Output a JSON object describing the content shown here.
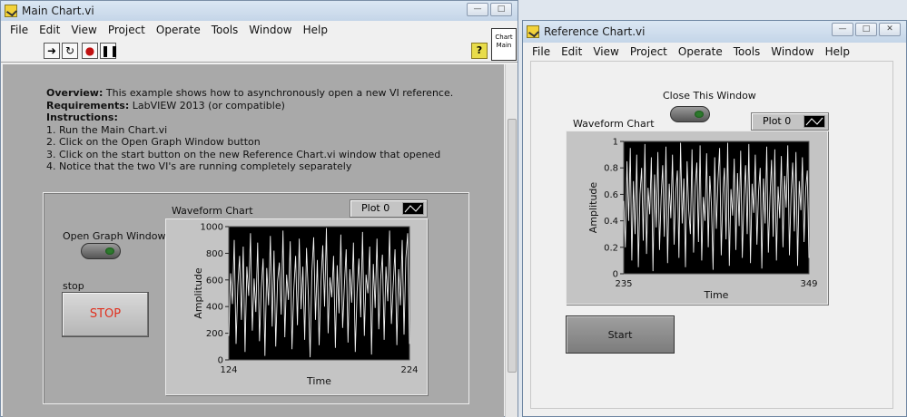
{
  "main_window": {
    "title": "Main Chart.vi",
    "menu": [
      "File",
      "Edit",
      "View",
      "Project",
      "Operate",
      "Tools",
      "Window",
      "Help"
    ],
    "toolbar_icons": [
      "run-arrow-icon",
      "run-continuously-icon",
      "abort-icon",
      "pause-icon"
    ],
    "help_label": "?",
    "vi_icon_text": "Chart Main",
    "overview": {
      "overview_label": "Overview:",
      "overview_text": " This example shows how to asynchronously open a new VI reference.",
      "requirements_label": "Requirements:",
      "requirements_text": " LabVIEW 2013 (or compatible)",
      "instructions_label": "Instructions:",
      "steps": [
        "1. Run the Main Chart.vi",
        "2. Click on the Open Graph Window button",
        "3. Click on the start button on the new Reference Chart.vi window that opened",
        "4. Notice that the two VI's are running completely separately"
      ]
    },
    "open_graph_label": "Open Graph Window",
    "stop_label": "stop",
    "stop_button_text": "STOP",
    "chart": {
      "title": "Waveform Chart",
      "legend": "Plot 0",
      "xlabel": "Time",
      "ylabel": "Amplitude"
    }
  },
  "reference_window": {
    "title": "Reference Chart.vi",
    "menu": [
      "File",
      "Edit",
      "View",
      "Project",
      "Operate",
      "Tools",
      "Window",
      "Help"
    ],
    "close_label": "Close This Window",
    "start_button_text": "Start",
    "chart": {
      "title": "Waveform Chart",
      "legend": "Plot 0",
      "xlabel": "Time",
      "ylabel": "Amplitude"
    }
  },
  "chart_data": [
    {
      "type": "line",
      "title": "Waveform Chart",
      "xlabel": "Time",
      "ylabel": "Amplitude",
      "series": [
        {
          "name": "Plot 0",
          "values": [
            180,
            650,
            420,
            900,
            120,
            560,
            780,
            300,
            850,
            60,
            700,
            480,
            950,
            220,
            610,
            360,
            880,
            140,
            540,
            760,
            30,
            690,
            410,
            930,
            250,
            820,
            100,
            590,
            730,
            340,
            970,
            170,
            640,
            450,
            890,
            80,
            520,
            780,
            260,
            910,
            380,
            700,
            150,
            840,
            490,
            20,
            660,
            920,
            300,
            750,
            110,
            580,
            860,
            400,
            990,
            200,
            620,
            470,
            780,
            90,
            710,
            350,
            940,
            240,
            570,
            830,
            130,
            680,
            430,
            880,
            60,
            510,
            760,
            320,
            960,
            180,
            640,
            500,
            850,
            40,
            720,
            390,
            910,
            230,
            600,
            790,
            150,
            700,
            440,
            970,
            270,
            560,
            830,
            110,
            680,
            410,
            900,
            190,
            760,
            950,
            120
          ]
        }
      ],
      "x": [
        124,
        224
      ],
      "xticks": [
        "124",
        "224"
      ],
      "ylim": [
        0,
        1000
      ],
      "yticks": [
        "0",
        "200",
        "400",
        "600",
        "800",
        "1000"
      ]
    },
    {
      "type": "line",
      "title": "Waveform Chart",
      "xlabel": "Time",
      "ylabel": "Amplitude",
      "series": [
        {
          "name": "Plot 0",
          "values": [
            0.55,
            0.2,
            0.85,
            0.4,
            0.95,
            0.1,
            0.7,
            0.3,
            0.9,
            0.05,
            0.6,
            0.8,
            0.25,
            0.98,
            0.15,
            0.65,
            0.45,
            0.88,
            0.02,
            0.75,
            0.35,
            0.92,
            0.18,
            0.58,
            0.82,
            0.28,
            0.96,
            0.08,
            0.68,
            0.42,
            0.9,
            0.22,
            0.62,
            0.78,
            0.12,
            0.99,
            0.38,
            0.72,
            0.05,
            0.85,
            0.48,
            0.3,
            0.94,
            0.16,
            0.66,
            0.84,
            0.24,
            0.97,
            0.1,
            0.58,
            0.4,
            0.91,
            0.2,
            0.74,
            0.52,
            0.03,
            0.88,
            0.34,
            0.7,
            0.95,
            0.14,
            0.6,
            0.8,
            0.26,
            0.99,
            0.06,
            0.64,
            0.44,
            0.87,
            0.18,
            0.76,
            0.36,
            0.93,
            0.12,
            0.56,
            0.82,
            0.3,
            0.98,
            0.08,
            0.68,
            0.46,
            0.9,
            0.22,
            0.62,
            0.8,
            0.04,
            0.72,
            0.38,
            0.96,
            0.16,
            0.58,
            0.86,
            0.28,
            0.94,
            0.1,
            0.66,
            0.42,
            0.89,
            0.2,
            0.74,
            0.5,
            0.97,
            0.14,
            0.6,
            0.84,
            0.32,
            0.92,
            0.06,
            0.7,
            0.48,
            0.88,
            0.24,
            0.64,
            0.78,
            0.12
          ]
        }
      ],
      "x": [
        235,
        349
      ],
      "xticks": [
        "235",
        "349"
      ],
      "ylim": [
        0,
        1
      ],
      "yticks": [
        "0",
        "0.2",
        "0.4",
        "0.6",
        "0.8",
        "1"
      ]
    }
  ]
}
